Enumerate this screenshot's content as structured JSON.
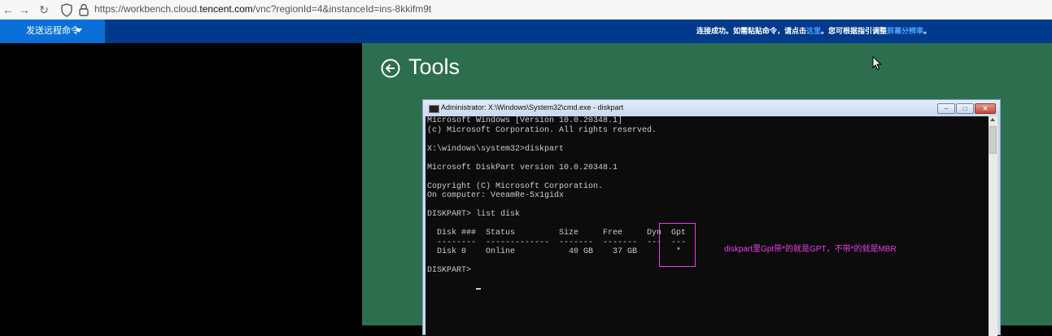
{
  "browser": {
    "url_prefix": "https://workbench.cloud.",
    "url_domain": "tencent.com",
    "url_suffix": "/vnc?regionId=4&instanceId=ins-8kkifm9t"
  },
  "vnc_toolbar": {
    "send_command_label": "发送远程命令",
    "message_part1": "连接成功。如需粘贴命令，请点击",
    "message_link1": "这里",
    "message_part2": "。您可根据指引调整",
    "message_link2": "屏幕分辨率",
    "message_part3": "。",
    "background_color": "#003a8c",
    "button_color": "#0a6fd8"
  },
  "remote": {
    "page_title": "Tools",
    "background_color": "#2d6e4f"
  },
  "cmd_window": {
    "title": "Administrator: X:\\Windows\\System32\\cmd.exe - diskpart",
    "lines": [
      "Microsoft Windows [Version 10.0.20348.1]",
      "(c) Microsoft Corporation. All rights reserved.",
      "",
      "X:\\windows\\system32>diskpart",
      "",
      "Microsoft DiskPart version 10.0.20348.1",
      "",
      "Copyright (C) Microsoft Corporation.",
      "On computer: VeeamRe-5x1gidx",
      "",
      "DISKPART> list disk",
      "",
      "  Disk ###  Status         Size     Free     Dyn  Gpt",
      "  --------  -------------  -------  -------  ---  ---",
      "  Disk 0    Online           40 GB    37 GB        *",
      "",
      "DISKPART> "
    ]
  },
  "annotation": {
    "text": "diskpart里Gpt带*的就是GPT，不带*的就是MBR",
    "color": "#e83ee8"
  }
}
